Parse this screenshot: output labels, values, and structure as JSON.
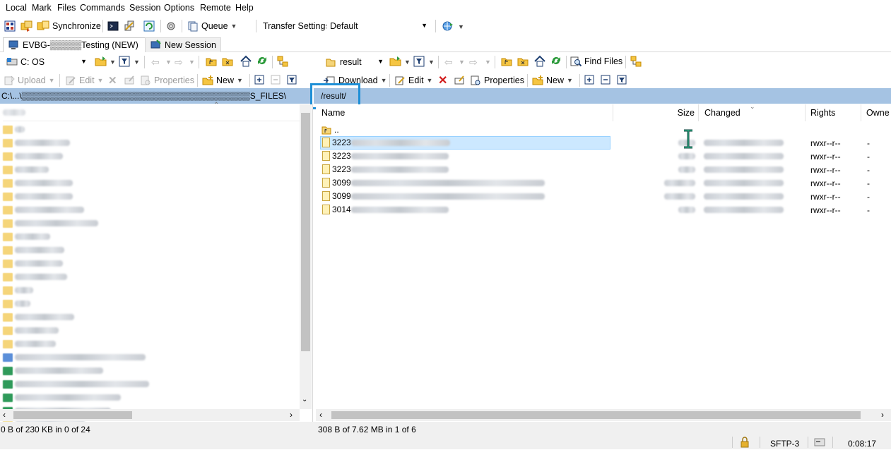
{
  "menu": [
    "Local",
    "Mark",
    "Files",
    "Commands",
    "Session",
    "Options",
    "Remote",
    "Help"
  ],
  "toolbar": {
    "synchronize": "Synchronize",
    "queue": "Queue",
    "transfer_settings_label": "Transfer Settings",
    "transfer_settings_value": "Default"
  },
  "tabs": {
    "session": "EVBG-▒▒▒▒▒Testing (NEW)",
    "new_session": "New Session"
  },
  "local": {
    "drive": "C: OS",
    "upload": "Upload",
    "edit": "Edit",
    "properties": "Properties",
    "new": "New",
    "path": "C:\\...\\▒▒▒▒▒▒▒▒▒▒▒▒▒▒▒▒▒▒▒▒▒▒▒▒▒▒▒▒▒▒▒▒▒▒▒▒▒▒S_FILES\\",
    "col_name": "Name",
    "status": "0 B of 230 KB in 0 of 24"
  },
  "remote": {
    "folder": "result",
    "find_files": "Find Files",
    "download": "Download",
    "edit": "Edit",
    "properties": "Properties",
    "new": "New",
    "path": "/result/",
    "columns": {
      "name": "Name",
      "size": "Size",
      "changed": "Changed",
      "rights": "Rights",
      "owner": "Owne"
    },
    "parent": "..",
    "files": [
      {
        "prefix": "3223",
        "rights": "rwxr--r--",
        "owner": "-"
      },
      {
        "prefix": "3223",
        "rights": "rwxr--r--",
        "owner": "-"
      },
      {
        "prefix": "3223",
        "rights": "rwxr--r--",
        "owner": "-"
      },
      {
        "prefix": "3099",
        "rights": "rwxr--r--",
        "owner": "-"
      },
      {
        "prefix": "3099",
        "rights": "rwxr--r--",
        "owner": "-"
      },
      {
        "prefix": "3014",
        "rights": "rwxr--r--",
        "owner": "-"
      }
    ],
    "status": "308 B of 7.62 MB in 1 of 6"
  },
  "statusbar": {
    "protocol": "SFTP-3",
    "elapsed": "0:08:17"
  },
  "colors": {
    "highlight_box": "#1e8fd6",
    "path_bar": "#a5c3e3",
    "selection": "#cce8ff"
  }
}
